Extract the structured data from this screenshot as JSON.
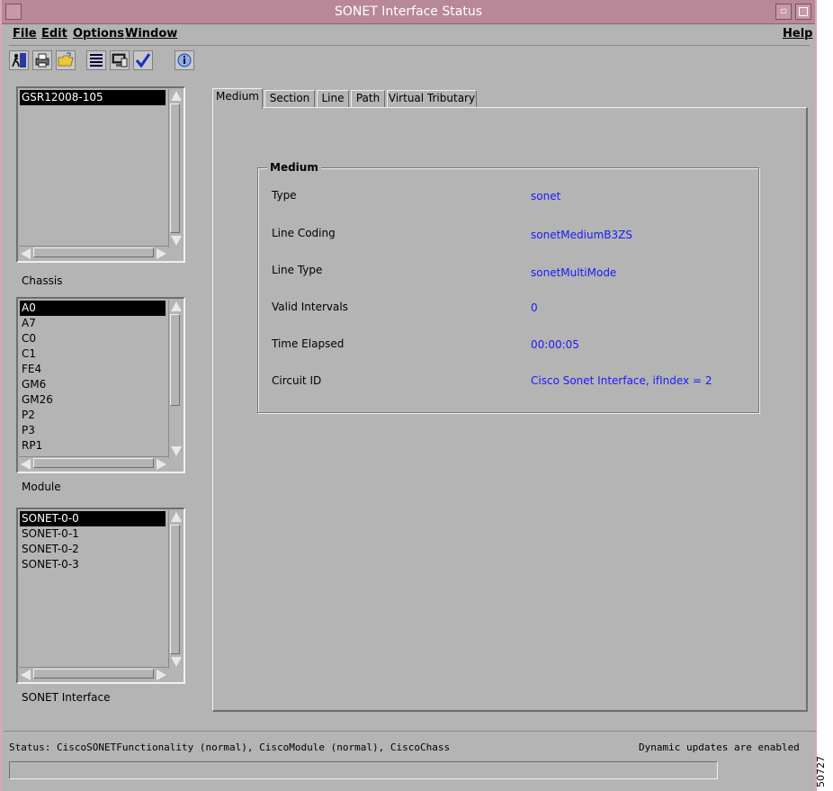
{
  "window": {
    "title": "SONET Interface Status"
  },
  "menu": {
    "file": "File",
    "edit": "Edit",
    "options": "Options",
    "window": "Window",
    "help": "Help"
  },
  "toolbar": {
    "icons": [
      "exit-icon",
      "print-icon",
      "open-folder-icon",
      "list-view-icon",
      "monitor-icon",
      "checkmark-icon",
      "info-icon"
    ]
  },
  "chassis_list": {
    "items": [
      "GSR12008-105"
    ],
    "selected": 0,
    "label": "Chassis"
  },
  "module_list": {
    "items": [
      "A0",
      "A7",
      "C0",
      "C1",
      "FE4",
      "GM6",
      "GM26",
      "P2",
      "P3",
      "RP1"
    ],
    "selected": 0,
    "label": "Module"
  },
  "interface_list": {
    "items": [
      "SONET-0-0",
      "SONET-0-1",
      "SONET-0-2",
      "SONET-0-3"
    ],
    "selected": 0,
    "label": "SONET Interface"
  },
  "tabs": [
    {
      "label": "Medium",
      "active": true
    },
    {
      "label": "Section",
      "active": false
    },
    {
      "label": "Line",
      "active": false
    },
    {
      "label": "Path",
      "active": false
    },
    {
      "label": "Virtual Tributary",
      "active": false
    }
  ],
  "medium": {
    "legend": "Medium",
    "rows": [
      {
        "label": "Type",
        "value": "sonet"
      },
      {
        "label": "Line Coding",
        "value": "sonetMediumB3ZS"
      },
      {
        "label": "Line Type",
        "value": "sonetMultiMode"
      },
      {
        "label": "Valid Intervals",
        "value": "0"
      },
      {
        "label": "Time Elapsed",
        "value": "00:00:05"
      },
      {
        "label": "Circuit ID",
        "value": "Cisco Sonet Interface, ifIndex = 2"
      }
    ]
  },
  "status": {
    "text": "Status: CiscoSONETFunctionality (normal), CiscoModule (normal), CiscoChassis (norm",
    "updates": "Dynamic updates are enabled"
  },
  "figure_number": "50727",
  "colors": {
    "title_bar": "#b88898",
    "value_text": "#1a1aff",
    "background": "#b4b4b4"
  }
}
